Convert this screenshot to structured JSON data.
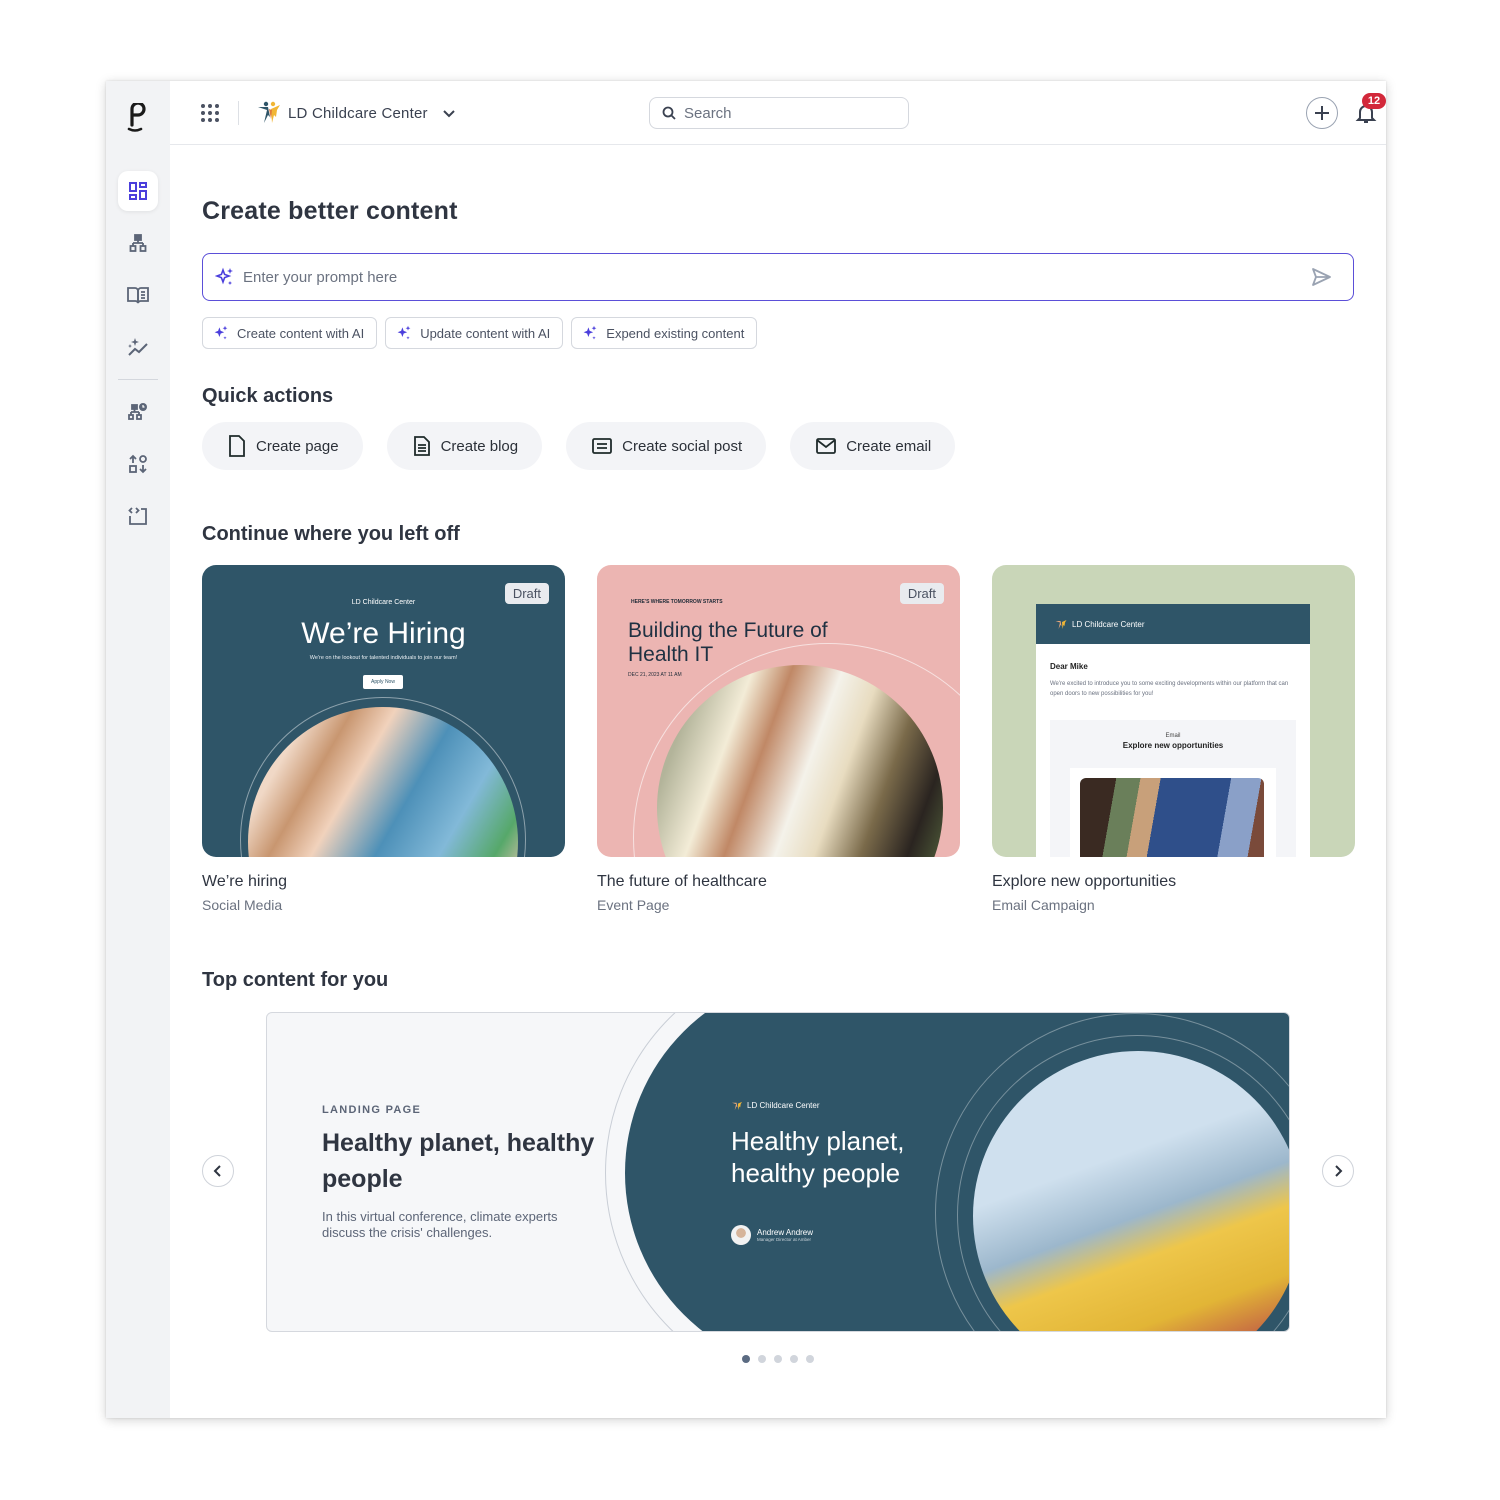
{
  "app": {
    "logo": "p-logo",
    "org_name": "LD Childcare Center",
    "search_placeholder": "Search",
    "notification_count": "12",
    "accent_color": "#5b4fd8",
    "brand_color": "#2f5568"
  },
  "sidebar": {
    "items": [
      {
        "icon": "dashboard-icon",
        "active": true
      },
      {
        "icon": "sitemap-icon",
        "active": false
      },
      {
        "icon": "book-icon",
        "active": false
      },
      {
        "icon": "ai-analytics-icon",
        "active": false
      },
      {
        "icon": "scheduled-sitemap-icon",
        "active": false
      },
      {
        "icon": "import-export-icon",
        "active": false
      },
      {
        "icon": "embed-code-icon",
        "active": false
      }
    ]
  },
  "main": {
    "title": "Create better content",
    "prompt_placeholder": "Enter your prompt here",
    "ai_chips": [
      "Create content with AI",
      "Update content with AI",
      "Expend existing content"
    ],
    "quick_actions_title": "Quick actions",
    "quick_actions": [
      "Create page",
      "Create blog",
      "Create social post",
      "Create email"
    ],
    "continue_title": "Continue where you left off",
    "cards": [
      {
        "title": "We’re hiring",
        "type": "Social Media",
        "badge": "Draft",
        "preview": {
          "brand": "LD Childcare Center",
          "headline": "We’re Hiring",
          "subline": "We're on the lookout for talented individuals to join our team!",
          "button": "Apply Now"
        }
      },
      {
        "title": "The future of healthcare",
        "type": "Event Page",
        "badge": "Draft",
        "preview": {
          "kicker": "HERE'S WHERE TOMORROW STARTS",
          "headline": "Building the Future of Health IT",
          "date": "DEC 21, 2023 AT 11 AM"
        }
      },
      {
        "title": "Explore new opportunities",
        "type": "Email Campaign",
        "preview": {
          "brand": "LD Childcare Center",
          "greeting": "Dear Mike",
          "body": "We're excited to introduce you to some exciting developments within our platform that can open doors to new possibilities for you!",
          "box_label": "Email",
          "box_title": "Explore new opportunities"
        }
      }
    ],
    "top_title": "Top content for you",
    "banner": {
      "kicker": "LANDING PAGE",
      "title": "Healthy planet, healthy people",
      "description": "In this virtual conference, climate experts discuss the crisis' challenges.",
      "preview_brand": "LD Childcare Center",
      "preview_headline": "Healthy planet, healthy people",
      "author_name": "Andrew Andrew",
      "author_role": "Manager Director at Amber"
    },
    "carousel": {
      "total": 5,
      "active": 1
    }
  }
}
